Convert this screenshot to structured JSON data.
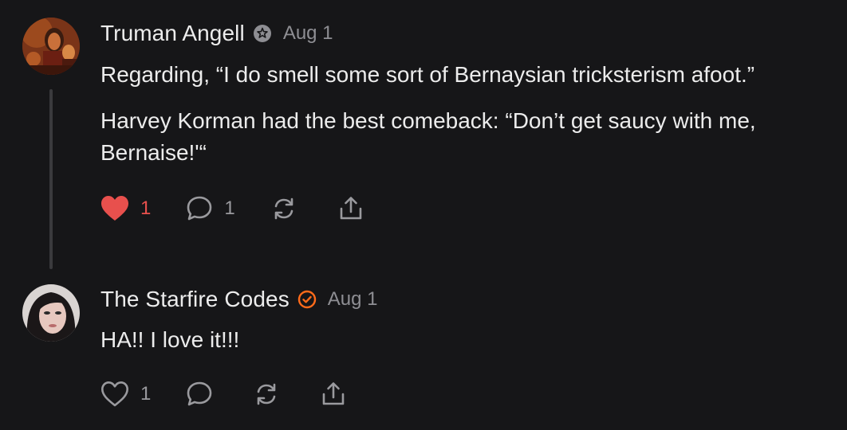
{
  "colors": {
    "background": "#161618",
    "text": "#ececec",
    "muted": "#8e8e93",
    "like_active": "#e8504d",
    "verified_badge": "#ff6b1a",
    "thread_line": "#3a3a3d"
  },
  "comments": [
    {
      "author": "Truman Angell",
      "badge_icon": "flower-badge-icon",
      "date": "Aug 1",
      "paragraphs": [
        "Regarding, “I do smell some sort of Bernaysian tricksterism afoot.”",
        "Harvey Korman had the best comeback: “Don’t get saucy with me, Bernaise!'“"
      ],
      "likes": "1",
      "liked": true,
      "replies": "1"
    },
    {
      "author": "The Starfire Codes",
      "badge_icon": "verified-check-badge-icon",
      "date": "Aug 1",
      "paragraphs": [
        "HA!! I love it!!!"
      ],
      "likes": "1",
      "liked": false,
      "replies": ""
    }
  ]
}
